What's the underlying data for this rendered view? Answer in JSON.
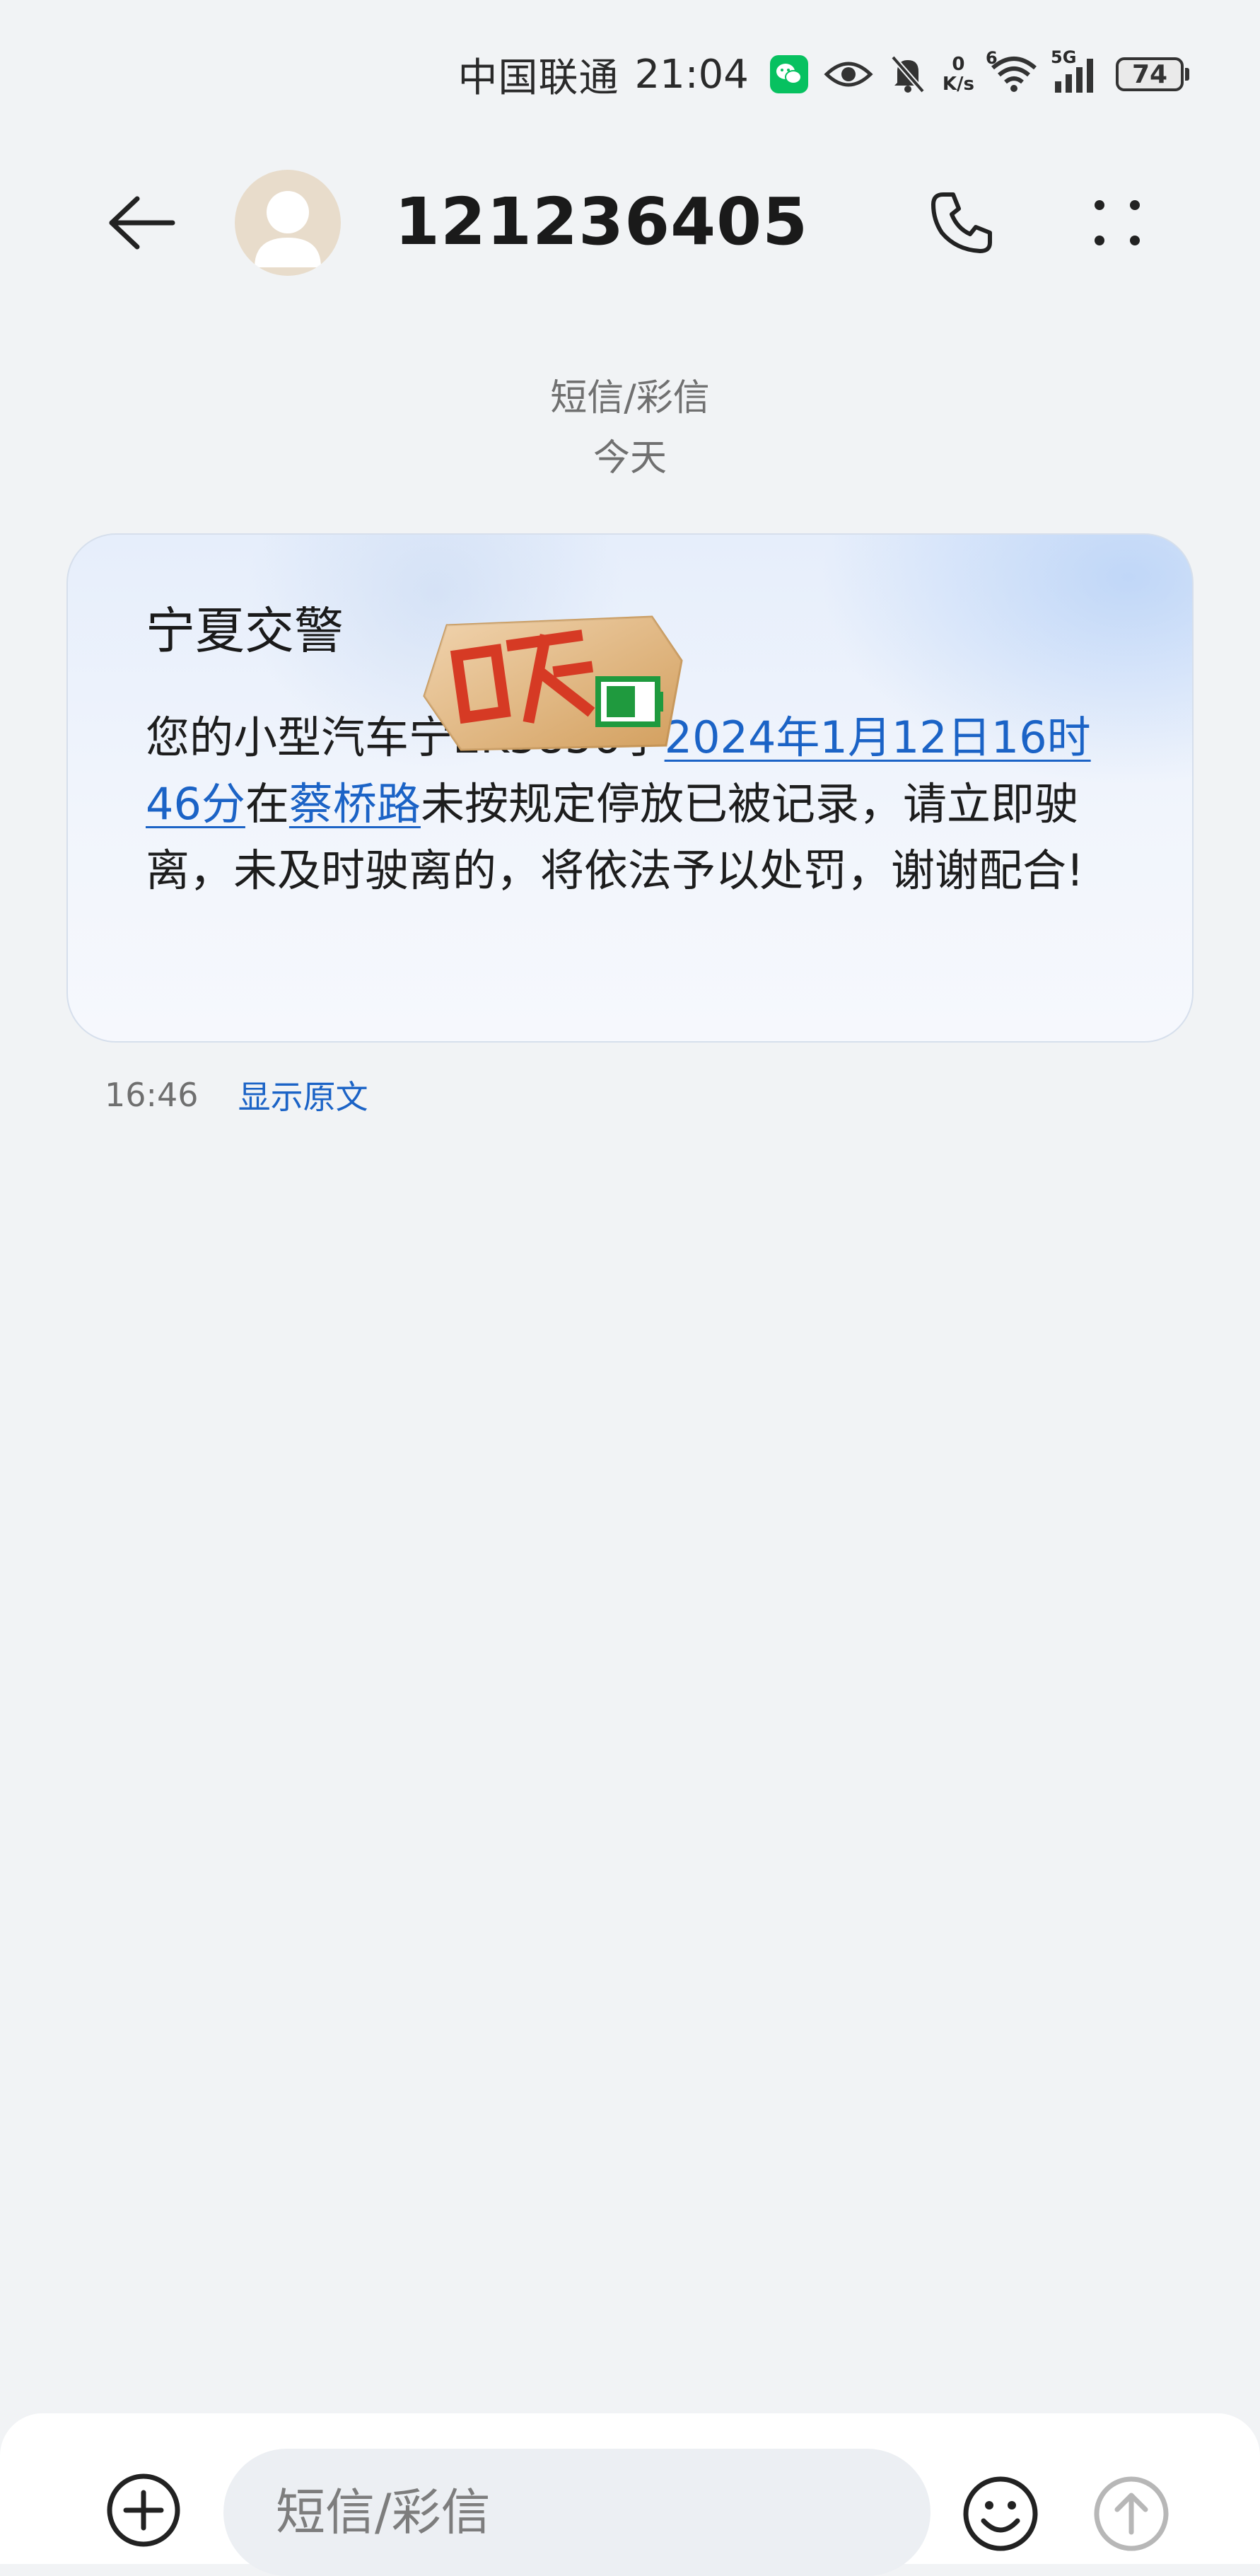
{
  "status_bar": {
    "carrier": "中国联通",
    "time": "21:04",
    "net_speed_value": "0",
    "net_speed_unit": "K/s",
    "wifi_label": "6",
    "cell_label": "5G",
    "battery": "74",
    "icons": [
      "wechat-icon",
      "eye-icon",
      "mute-bell-icon",
      "wifi-icon",
      "signal-icon",
      "battery-icon"
    ]
  },
  "header": {
    "title": "121236405",
    "icons": [
      "back-arrow-icon",
      "avatar",
      "phone-icon",
      "more-dots-icon"
    ]
  },
  "thread": {
    "channel": "短信/彩信",
    "date": "今天"
  },
  "message": {
    "sender": "宁夏交警",
    "text_before_date": "您的小型汽车宁EK5856于",
    "date_link": "2024年1月12日16时46分",
    "text_between": "在",
    "location_link": "蔡桥路",
    "text_after": "未按规定停放已被记录，请立即驶离，未及时驶离的，将依法予以处罚，谢谢配合!",
    "time": "16:46",
    "show_original": "显示原文"
  },
  "composer": {
    "placeholder": "短信/彩信",
    "icons": [
      "add-circle-icon",
      "emoji-icon",
      "send-arrow-icon"
    ]
  },
  "colors": {
    "link": "#1b63c6",
    "background": "#f1f3f5",
    "wechat_green": "#07c160"
  }
}
